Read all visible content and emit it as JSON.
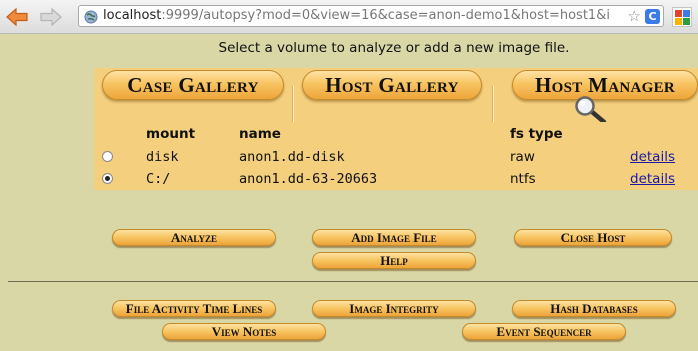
{
  "browser": {
    "url_host": "localhost",
    "url_rest": ":9999/autopsy?mod=0&view=16&case=anon-demo1&host=host1&i",
    "reload_glyph": "C",
    "icons": {
      "back": "back-arrow-icon",
      "forward": "forward-arrow-icon",
      "site": "globe-icon",
      "bookmark": "star-icon",
      "reload": "reload-icon",
      "search_engine": "google-icon"
    }
  },
  "page": {
    "prompt": "Select a volume to analyze or add a new image file."
  },
  "tabs": [
    {
      "label": "Case Gallery"
    },
    {
      "label": "Host Gallery"
    },
    {
      "label": "Host Manager"
    }
  ],
  "volume_table": {
    "headers": {
      "mount": "mount",
      "name": "name",
      "fs_type": "fs type"
    },
    "rows": [
      {
        "mount": "disk",
        "name": "anon1.dd-disk",
        "fs_type": "raw",
        "link": "details",
        "selected": false
      },
      {
        "mount": "C:/",
        "name": "anon1.dd-63-20663",
        "fs_type": "ntfs",
        "link": "details",
        "selected": true
      }
    ]
  },
  "actions": {
    "analyze": "Analyze",
    "add_image_file": "Add Image File",
    "close_host": "Close Host",
    "help": "Help"
  },
  "tools": {
    "file_activity_time_lines": "File Activity Time Lines",
    "image_integrity": "Image Integrity",
    "hash_databases": "Hash Databases",
    "view_notes": "View Notes",
    "event_sequencer": "Event Sequencer"
  },
  "colors": {
    "page_background": "#d9d7a6",
    "panel": "#f4cf7e",
    "button_gradient_top": "#ffe2a2",
    "button_gradient_bottom": "#eda43a",
    "link": "#1a1aa6"
  }
}
